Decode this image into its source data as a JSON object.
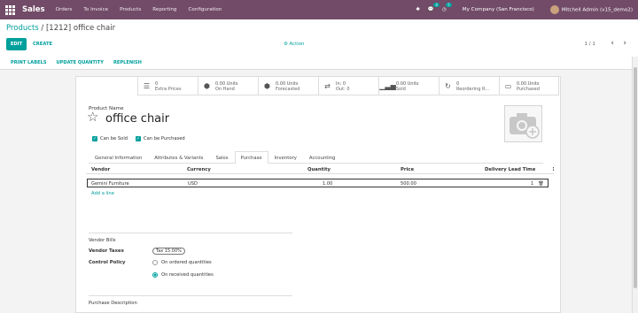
{
  "nav": {
    "app": "Sales",
    "menu": [
      "Orders",
      "To Invoice",
      "Products",
      "Reporting",
      "Configuration"
    ],
    "company": "My Company (San Francisco)",
    "user": "Mitchell Admin (v15_demo2)",
    "chat_count": "4",
    "activity_count": "5"
  },
  "breadcrumb": {
    "parent": "Products",
    "current": " / [1212] office chair"
  },
  "control": {
    "edit": "EDIT",
    "create": "CREATE",
    "action": "Action",
    "pager": "1 / 1"
  },
  "status_buttons": [
    "PRINT LABELS",
    "UPDATE QUANTITY",
    "REPLENISH"
  ],
  "smart_buttons": [
    {
      "icon": "list-icon",
      "value": "0",
      "label": "Extra Prices"
    },
    {
      "icon": "cubes-icon",
      "value": "0.00 Units",
      "label": "On Hand"
    },
    {
      "icon": "cubes-icon",
      "value": "0.00 Units",
      "label": "Forecasted"
    },
    {
      "icon": "exchange-icon",
      "value": "In:  0",
      "label": "Out:  0"
    },
    {
      "icon": "bar-chart-icon",
      "value": "0.00 Units",
      "label": "Sold"
    },
    {
      "icon": "refresh-icon",
      "value": "0",
      "label": "Reordering R..."
    },
    {
      "icon": "credit-card-icon",
      "value": "0.00 Units",
      "label": "Purchased"
    }
  ],
  "product": {
    "name_label": "Product Name",
    "name": "office chair",
    "can_be_sold": "Can be Sold",
    "can_be_purchased": "Can be Purchased"
  },
  "tabs": [
    "General Information",
    "Attributes & Variants",
    "Sales",
    "Purchase",
    "Inventory",
    "Accounting"
  ],
  "active_tab": "Purchase",
  "table": {
    "columns": [
      "Vendor",
      "Currency",
      "Quantity",
      "Price",
      "Delivery Lead Time"
    ],
    "rows": [
      {
        "vendor": "Gemini Furniture",
        "currency": "USD",
        "quantity": "1.00",
        "price": "500.00",
        "lead": "1"
      }
    ],
    "add_line": "Add a line"
  },
  "vendor_bills": {
    "section": "Vendor Bills",
    "taxes_label": "Vendor Taxes",
    "tax": "Tax 15.00%",
    "policy_label": "Control Policy",
    "option_ordered": "On ordered quantities",
    "option_received": "On received quantities",
    "selected": "On received quantities"
  },
  "purchase_description": "Purchase Description",
  "colors": {
    "brand": "#714b67",
    "accent": "#00a09d"
  }
}
